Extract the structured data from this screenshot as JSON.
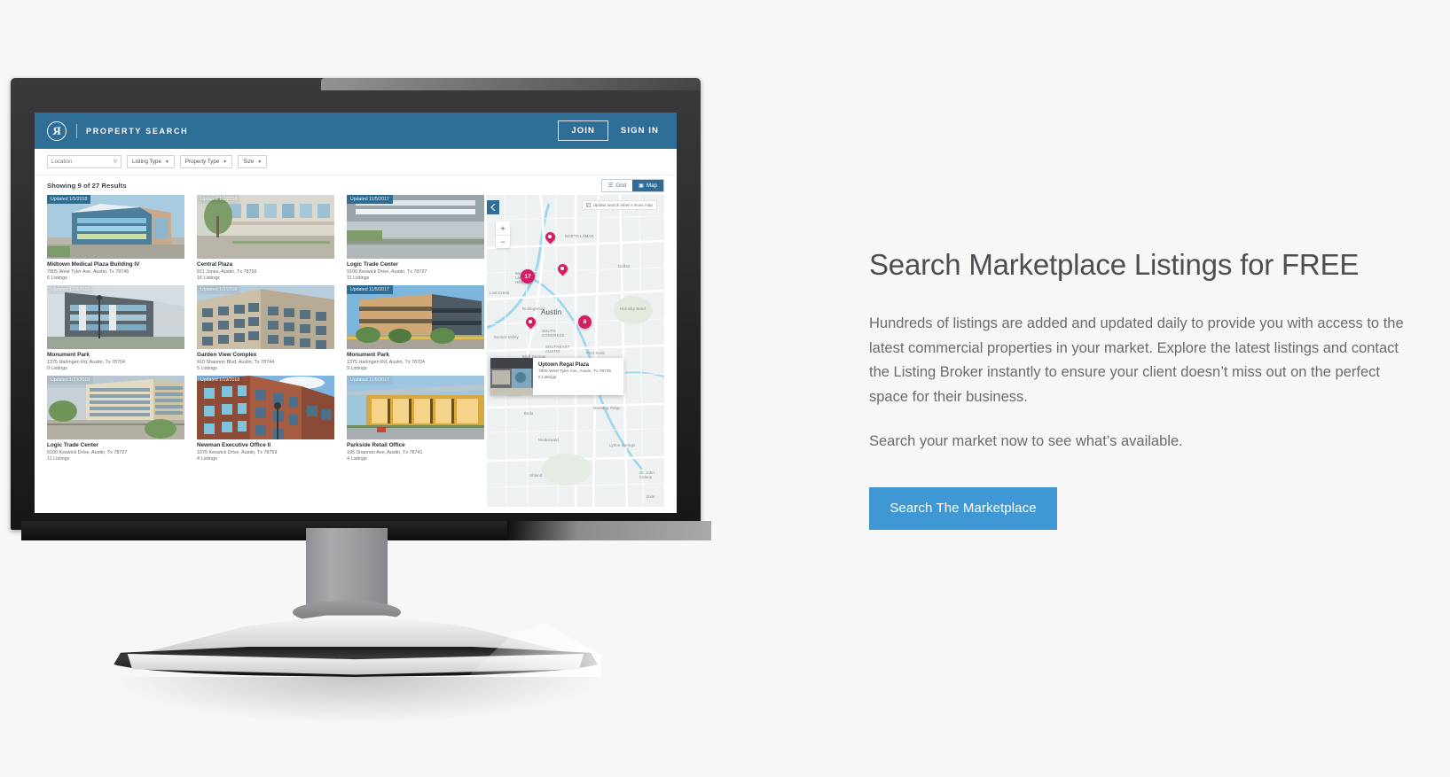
{
  "app": {
    "header": {
      "logo_glyph": "R",
      "brand": "PROPERTY SEARCH",
      "join_label": "JOIN",
      "signin_label": "SIGN IN"
    },
    "filters": {
      "location_placeholder": "Location",
      "search_icon": "search-icon",
      "pills": [
        {
          "label": "Listing Type"
        },
        {
          "label": "Property Type"
        },
        {
          "label": "Size"
        }
      ]
    },
    "results": {
      "count_text": "Showing 9 of 27 Results",
      "view_toggle": [
        {
          "label": "Grid",
          "icon": "grid-icon",
          "active": false
        },
        {
          "label": "Map",
          "icon": "map-icon",
          "active": true
        }
      ]
    },
    "cards": [
      {
        "badge": "Updated 1/5/2018",
        "badge_solid": true,
        "title": "Midtown Medical Plaza Building IV",
        "address": "7805 West Tyler Ave, Austin, Tx 78745",
        "listings": "6 Listings"
      },
      {
        "badge": "Updated 1/2/2018",
        "badge_solid": false,
        "title": "Central Plaza",
        "address": "811 Jones, Austin, Tx 78756",
        "listings": "16 Listings"
      },
      {
        "badge": "Updated 11/5/2017",
        "badge_solid": true,
        "title": "Logic Trade Center",
        "address": "9100 Keswick Drive, Austin, Tx 78727",
        "listings": "11 Listings"
      },
      {
        "badge": "Updated 1/19/2018",
        "badge_solid": false,
        "title": "Monument  Park",
        "address": "1375 Harlingen Rd, Austin, Tx 78704",
        "listings": "9 Listings"
      },
      {
        "badge": "Updated 1/2/2018",
        "badge_solid": false,
        "title": "Garden View Complex",
        "address": "410 Shannon Blvd, Austin, Tx 78744",
        "listings": "5 Listings"
      },
      {
        "badge": "Updated 11/5/2017",
        "badge_solid": true,
        "title": "Monument  Park",
        "address": "1375 Harlingen Rd, Austin, Tx 78704",
        "listings": "9 Listings"
      },
      {
        "badge": "Updated 1/23/2018",
        "badge_solid": false,
        "title": "Logic Trade Center",
        "address": "9100 Keswick Drive, Austin, Tx 78727",
        "listings": "11 Listings"
      },
      {
        "badge": "Updated 1/19/2018",
        "badge_solid": false,
        "title": "Newman Executive Office II",
        "address": "1675 Keswick Drive, Austin, Tx 78759",
        "listings": "4 Listings"
      },
      {
        "badge": "Updated 11/5/2017",
        "badge_solid": false,
        "title": "Parkside Retail Office",
        "address": "195 Shannon Ave, Austin, Tx 78741",
        "listings": "4 Listings"
      }
    ],
    "map": {
      "collapse_icon": "chevron-left-icon",
      "update_checkbox_label": "Update search when I move map",
      "checkbox_checked": true,
      "checkbox_glyph": "✓",
      "zoom_in_label": "+",
      "zoom_out_label": "−",
      "clusters": [
        {
          "value": "17"
        },
        {
          "value": "8"
        }
      ],
      "labels": [
        {
          "text": "NORTH LAMAR"
        },
        {
          "text": "Daffan"
        },
        {
          "text": "West Lake Hills"
        },
        {
          "text": "Lost Creek"
        },
        {
          "text": "Rollingwood"
        },
        {
          "text": "Austin"
        },
        {
          "text": "Sunset Valley"
        },
        {
          "text": "SOUTH CONGRESS"
        },
        {
          "text": "SOUTHEAST AUSTIN"
        },
        {
          "text": "Hornsby Bend"
        },
        {
          "text": "Bluff Springs"
        },
        {
          "text": "Pilot Knob"
        },
        {
          "text": "Buda"
        },
        {
          "text": "Mustang Ridge"
        },
        {
          "text": "Niederwald"
        },
        {
          "text": "Uhland"
        },
        {
          "text": "Lytton Springs"
        },
        {
          "text": "St. John Colony"
        },
        {
          "text": "Dale"
        }
      ],
      "popup": {
        "title": "Uptown Regal Plaza",
        "address": "7805 West Tyler Ave, Austin, Tx 78745",
        "listings": "6 Listings"
      }
    }
  },
  "marketing": {
    "headline": "Search Marketplace Listings for FREE",
    "body": "Hundreds of listings are added and updated daily to provide you with access to the latest commercial properties in your market. Explore the latest listings and contact the Listing Broker instantly to ensure your client doesn’t miss out on the perfect space for their business.",
    "subtext": "Search your market now to see what’s available.",
    "cta_label": "Search The Marketplace"
  },
  "colors": {
    "brand_blue": "#2e6e96",
    "cta_blue": "#3f97d3",
    "pin_pink": "#d21f63",
    "page_bg": "#f7f7f7"
  }
}
